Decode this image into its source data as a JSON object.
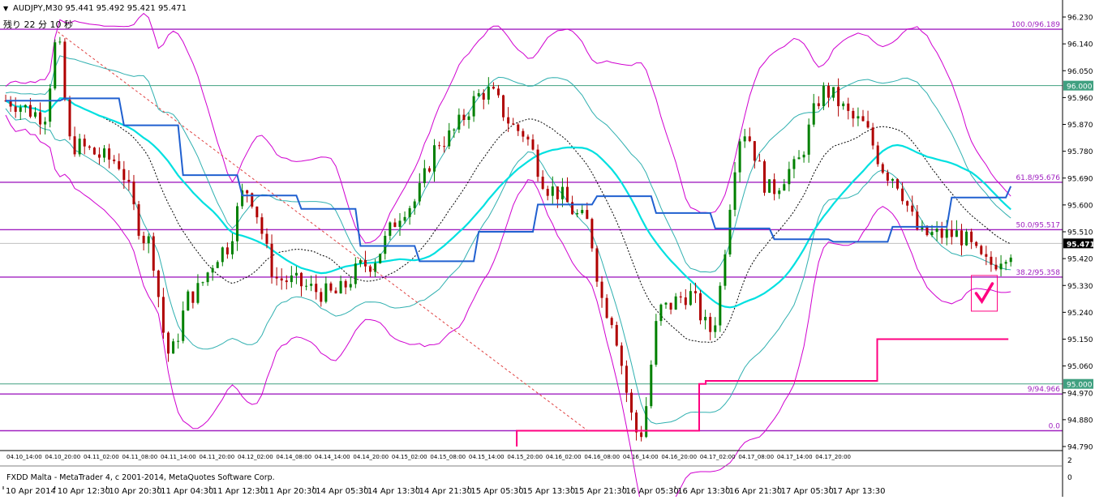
{
  "header": {
    "symbol_line": "AUDJPY,M30  95.441 95.492 95.421 95.471",
    "countdown": "残り 22 分 10 秒"
  },
  "footer": {
    "copyright": "FXDD Malta - MetaTrader 4, c 2001-2014, MetaQuotes Software Corp."
  },
  "indicator_window": {
    "scale_labels": [
      "2",
      "0"
    ]
  },
  "colors": {
    "bull_candle": "#008000",
    "bear_candle": "#b00000",
    "bollinger_outer": "#d000d0",
    "bollinger_inner": "#30b0b0",
    "moving_average": "#00e0e0",
    "baseline": "#2060d0",
    "fibonacci": "#a020c0",
    "stop_line": "#ff0080",
    "horizontal_line": "#40a080",
    "trendline": "#e04040"
  },
  "chart_data": {
    "type": "candlestick",
    "symbol": "AUDJPY",
    "timeframe": "M30",
    "ohlc_current": {
      "open": 95.441,
      "high": 95.492,
      "low": 95.421,
      "close": 95.471
    },
    "current_price_label": "95.471",
    "current_price": 95.471,
    "ylim": [
      94.79,
      96.23
    ],
    "y_ticks": [
      "96.230",
      "96.140",
      "96.050",
      "95.960",
      "95.870",
      "95.780",
      "95.690",
      "95.600",
      "95.510",
      "95.420",
      "95.330",
      "95.240",
      "95.150",
      "95.060",
      "94.970",
      "94.880",
      "94.790"
    ],
    "x_ticks_top": [
      "04.10_14:00",
      "04.10_20:00",
      "04.11_02:00",
      "04.11_08:00",
      "04.11_14:00",
      "04.11_20:00",
      "04.12_02:00",
      "04.14_08:00",
      "04.14_14:00",
      "04.14_20:00",
      "04.15_02:00",
      "04.15_08:00",
      "04.15_14:00",
      "04.15_20:00",
      "04.16_02:00",
      "04.16_08:00",
      "04.16_14:00",
      "04.16_20:00",
      "04.17_02:00",
      "04.17_08:00",
      "04.17_14:00",
      "04.17_20:00"
    ],
    "x_ticks_bottom": [
      "10 Apr 2014",
      "10 Apr 12:30",
      "10 Apr 20:30",
      "11 Apr 04:30",
      "11 Apr 12:30",
      "11 Apr 20:30",
      "14 Apr 05:30",
      "14 Apr 13:30",
      "14 Apr 21:30",
      "15 Apr 05:30",
      "15 Apr 13:30",
      "15 Apr 21:30",
      "16 Apr 05:30",
      "16 Apr 13:30",
      "16 Apr 21:30",
      "17 Apr 05:30",
      "17 Apr 13:30"
    ],
    "horizontal_lines": [
      {
        "price": 96.0,
        "label": "96.000"
      },
      {
        "price": 95.0,
        "label": "95.000"
      }
    ],
    "fibonacci_levels": [
      {
        "label": "100.0/96.189",
        "price": 96.189
      },
      {
        "label": "61.8/95.676",
        "price": 95.676
      },
      {
        "label": "50.0/95.517",
        "price": 95.517
      },
      {
        "label": "38.2/95.358",
        "price": 95.358
      },
      {
        "label": "9/94.966",
        "price": 94.966
      },
      {
        "label": "0.0",
        "price": 94.843
      }
    ],
    "anchors": [
      {
        "t": 0.0,
        "p": 95.95
      },
      {
        "t": 0.035,
        "p": 95.9
      },
      {
        "t": 0.047,
        "p": 96.15
      },
      {
        "t": 0.06,
        "p": 95.8
      },
      {
        "t": 0.1,
        "p": 95.75
      },
      {
        "t": 0.13,
        "p": 95.48
      },
      {
        "t": 0.15,
        "p": 95.1
      },
      {
        "t": 0.17,
        "p": 95.3
      },
      {
        "t": 0.2,
        "p": 95.45
      },
      {
        "t": 0.22,
        "p": 95.65
      },
      {
        "t": 0.25,
        "p": 95.35
      },
      {
        "t": 0.3,
        "p": 95.3
      },
      {
        "t": 0.33,
        "p": 95.4
      },
      {
        "t": 0.37,
        "p": 95.6
      },
      {
        "t": 0.4,
        "p": 95.82
      },
      {
        "t": 0.44,
        "p": 95.98
      },
      {
        "t": 0.47,
        "p": 95.85
      },
      {
        "t": 0.5,
        "p": 95.65
      },
      {
        "t": 0.53,
        "p": 95.55
      },
      {
        "t": 0.55,
        "p": 95.25
      },
      {
        "t": 0.58,
        "p": 94.83
      },
      {
        "t": 0.6,
        "p": 95.25
      },
      {
        "t": 0.625,
        "p": 95.3
      },
      {
        "t": 0.645,
        "p": 95.18
      },
      {
        "t": 0.675,
        "p": 95.85
      },
      {
        "t": 0.7,
        "p": 95.65
      },
      {
        "t": 0.72,
        "p": 95.72
      },
      {
        "t": 0.75,
        "p": 95.98
      },
      {
        "t": 0.78,
        "p": 95.88
      },
      {
        "t": 0.81,
        "p": 95.7
      },
      {
        "t": 0.84,
        "p": 95.5
      },
      {
        "t": 0.87,
        "p": 95.5
      },
      {
        "t": 0.9,
        "p": 95.4
      },
      {
        "t": 0.92,
        "p": 95.45
      }
    ]
  }
}
